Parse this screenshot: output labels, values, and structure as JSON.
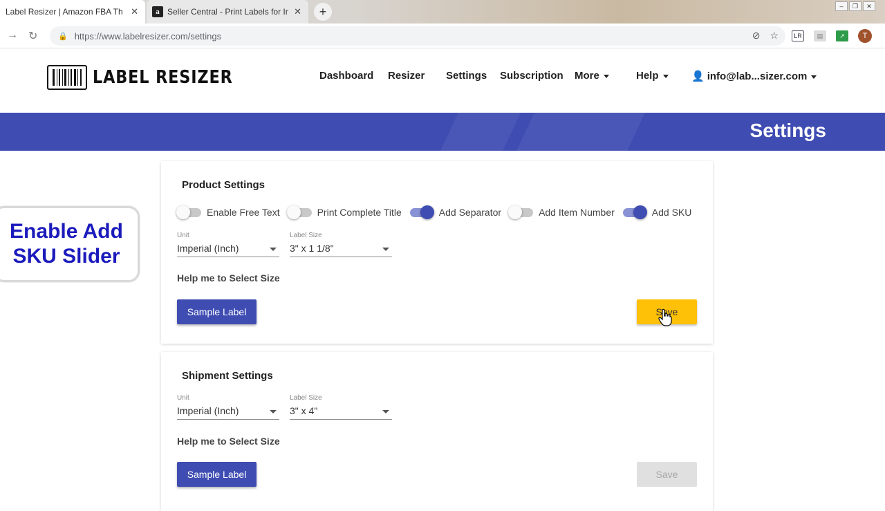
{
  "browser": {
    "tabs": [
      {
        "title": "Label Resizer | Amazon FBA Ther",
        "active": true
      },
      {
        "title": "Seller Central - Print Labels for In",
        "active": false
      }
    ],
    "address": "https://www.labelresizer.com/settings",
    "profile_initial": "T"
  },
  "header": {
    "logo_text": "LABEL RESIZER",
    "nav": {
      "dashboard": "Dashboard",
      "resizer": "Resizer",
      "settings": "Settings",
      "subscription": "Subscription",
      "more": "More",
      "help": "Help",
      "account": "info@lab...sizer.com"
    }
  },
  "banner": {
    "title": "Settings"
  },
  "callout": {
    "line1": "Enable Add",
    "line2": "SKU Slider"
  },
  "product_settings": {
    "title": "Product Settings",
    "toggles": [
      {
        "label": "Enable Free Text",
        "on": false
      },
      {
        "label": "Print Complete Title",
        "on": false
      },
      {
        "label": "Add Separator",
        "on": true
      },
      {
        "label": "Add Item Number",
        "on": false
      },
      {
        "label": "Add SKU",
        "on": true
      }
    ],
    "unit": {
      "label": "Unit",
      "value": "Imperial (Inch)"
    },
    "label_size": {
      "label": "Label Size",
      "value": "3\" x 1 1/8\""
    },
    "help_link": "Help me to Select Size",
    "sample_button": "Sample Label",
    "save_button": "Save"
  },
  "shipment_settings": {
    "title": "Shipment Settings",
    "unit": {
      "label": "Unit",
      "value": "Imperial (Inch)"
    },
    "label_size": {
      "label": "Label Size",
      "value": "3\" x 4\""
    },
    "help_link": "Help me to Select Size",
    "sample_button": "Sample Label",
    "save_button": "Save"
  },
  "colors": {
    "primary": "#3f4db3",
    "save": "#ffc107",
    "callout_text": "#1b1bbd"
  }
}
